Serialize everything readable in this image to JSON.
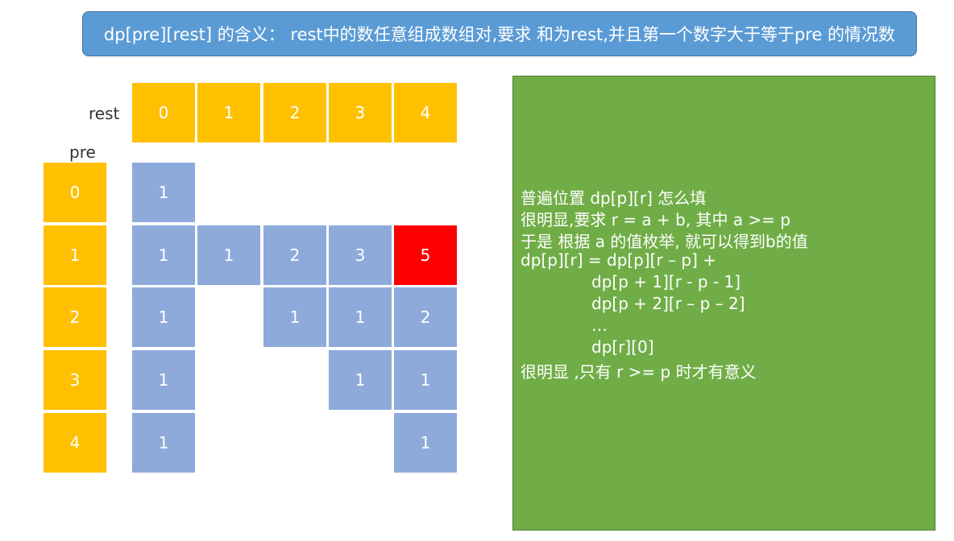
{
  "title": "dp[pre][rest] 的含义： rest中的数任意组成数组对,要求 和为rest,并且第一个数字大于等于pre 的情况数",
  "rest_label": "rest",
  "pre_label": "pre",
  "rest_headers": [
    "0",
    "1",
    "2",
    "3",
    "4"
  ],
  "pre_headers": [
    "0",
    "1",
    "2",
    "3",
    "4"
  ],
  "table": {
    "row_0": [
      "1",
      "",
      "",
      "",
      ""
    ],
    "row_1": [
      "1",
      "1",
      "2",
      "3",
      "5"
    ],
    "row_2": [
      "1",
      "",
      "1",
      "1",
      "2"
    ],
    "row_3": [
      "1",
      "",
      "",
      "1",
      "1"
    ],
    "row_4": [
      "1",
      "",
      "",
      "",
      "1"
    ]
  },
  "highlight_color": "#ff0000",
  "notes": [
    "普遍位置 dp[p][r] 怎么填",
    "很明显,要求 r = a + b, 其中 a >= p",
    "于是 根据 a 的值枚举, 就可以得到b的值",
    "dp[p][r] = dp[p][r – p] +",
    "dp[p + 1][r -  p - 1]",
    "dp[p + 2][r –  p – 2]",
    "…",
    "dp[r][0]",
    "很明显 ,只有 r >= p 时才有意义"
  ]
}
